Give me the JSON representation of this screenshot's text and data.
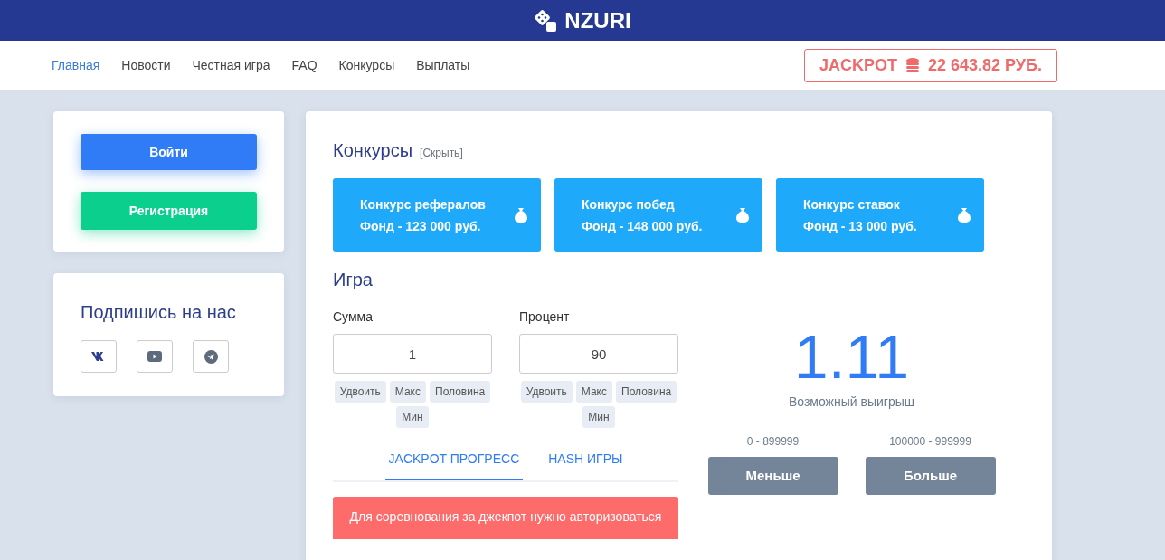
{
  "header": {
    "logo": "NZURI"
  },
  "nav": [
    {
      "label": "Главная",
      "selected": true
    },
    {
      "label": "Новости",
      "selected": false
    },
    {
      "label": "Честная игра",
      "selected": false
    },
    {
      "label": "FAQ",
      "selected": false
    },
    {
      "label": "Конкурсы",
      "selected": false
    },
    {
      "label": "Выплаты",
      "selected": false
    }
  ],
  "jackpot": {
    "label": "JACKPOT",
    "amount": "22 643.82 РУБ."
  },
  "auth": {
    "login": "Войти",
    "register": "Регистрация"
  },
  "social": {
    "title": "Подпишись на нас",
    "links": [
      {
        "kind": "vk"
      },
      {
        "kind": "youtube"
      },
      {
        "kind": "telegram"
      }
    ]
  },
  "contests": {
    "title": "Конкурсы",
    "hide": "[Скрыть]",
    "items": [
      {
        "name": "Конкурс рефералов",
        "fund": "Фонд - 123 000 руб."
      },
      {
        "name": "Конкурс побед",
        "fund": "Фонд - 148 000 руб."
      },
      {
        "name": "Конкурс ставок",
        "fund": "Фонд - 13 000 руб."
      }
    ]
  },
  "game": {
    "title": "Игра",
    "fields": [
      {
        "label": "Сумма",
        "value": "1",
        "buttons": [
          "Удвоить",
          "Макс",
          "Половина",
          "Мин"
        ]
      },
      {
        "label": "Процент",
        "value": "90",
        "buttons": [
          "Удвоить",
          "Макс",
          "Половина",
          "Мин"
        ]
      }
    ],
    "payout": "1.11",
    "payout_label": "Возможный выигрыш",
    "bets": [
      {
        "range": "0 - 899999",
        "label": "Меньше"
      },
      {
        "range": "100000 - 999999",
        "label": "Больше"
      }
    ],
    "tabs": [
      {
        "label": "JACKPOT ПРОГРЕСС",
        "selected": true
      },
      {
        "label": "HASH ИГРЫ",
        "selected": false
      }
    ],
    "alert": "Для соревнования за джекпот нужно авторизоваться"
  }
}
